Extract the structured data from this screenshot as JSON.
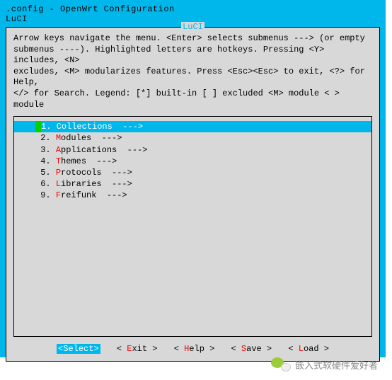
{
  "title": ".config - OpenWrt Configuration",
  "breadcrumb": "LuCI",
  "box_title": "LuCI",
  "help": {
    "l1": "Arrow keys navigate the menu.  <Enter> selects submenus ---> (or empty",
    "l2": "submenus ----).  Highlighted letters are hotkeys.  Pressing <Y> includes, <N>",
    "l3": "excludes, <M> modularizes features.  Press <Esc><Esc> to exit, <?> for Help,",
    "l4": "</> for Search.  Legend: [*] built-in  [ ] excluded  <M> module  < > module"
  },
  "menu": [
    {
      "num": "1.",
      "hot": "C",
      "rest": "ollections  --->",
      "selected": true
    },
    {
      "num": "2.",
      "hot": "M",
      "rest": "odules  --->",
      "selected": false
    },
    {
      "num": "3.",
      "hot": "A",
      "rest": "pplications  --->",
      "selected": false
    },
    {
      "num": "4.",
      "hot": "T",
      "rest": "hemes  --->",
      "selected": false
    },
    {
      "num": "5.",
      "hot": "P",
      "rest": "rotocols  --->",
      "selected": false
    },
    {
      "num": "6.",
      "hot": "L",
      "rest": "ibraries  --->",
      "selected": false
    },
    {
      "num": "9.",
      "hot": "F",
      "rest": "reifunk  --->",
      "selected": false
    }
  ],
  "buttons": {
    "select": {
      "open": "<",
      "hot": "S",
      "rest": "elect>",
      "active": true
    },
    "exit": {
      "open": "< ",
      "hot": "E",
      "rest": "xit >",
      "active": false
    },
    "help": {
      "open": "< ",
      "hot": "H",
      "rest": "elp >",
      "active": false
    },
    "save": {
      "open": "< ",
      "hot": "S",
      "rest": "ave >",
      "active": false
    },
    "load": {
      "open": "< ",
      "hot": "L",
      "rest": "oad >",
      "active": false
    }
  },
  "footer": "嵌入式软硬件爱好者"
}
